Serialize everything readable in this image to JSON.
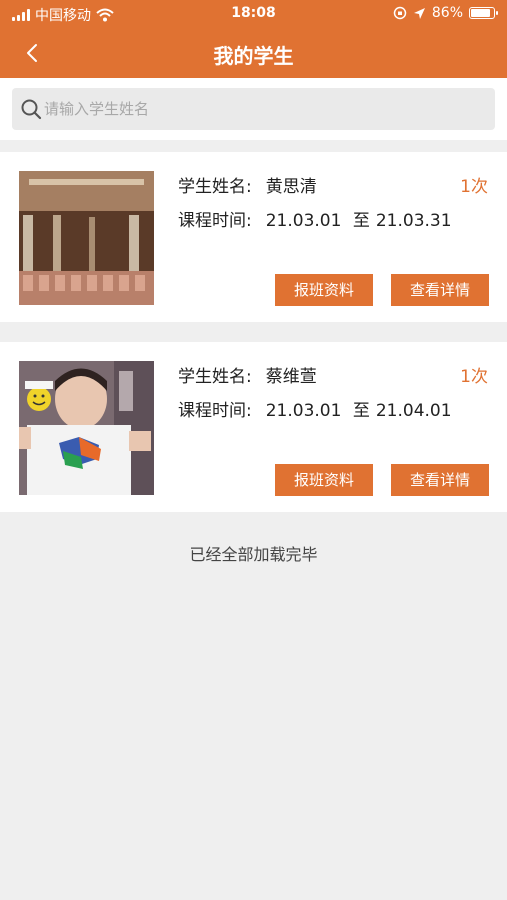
{
  "status_bar": {
    "carrier": "中国移动",
    "time": "18:08",
    "battery": "86%",
    "battery_level": 0.86
  },
  "nav": {
    "title": "我的学生",
    "back_icon": "chevron-left-icon"
  },
  "search": {
    "placeholder": "请输入学生姓名",
    "value": "",
    "icon": "search-icon"
  },
  "students": [
    {
      "name_label": "学生姓名:",
      "name": "黄思清",
      "time_label": "课程时间:",
      "start": "21.03.01",
      "sep": "至",
      "end": "21.03.31",
      "count": "1次",
      "enroll_label": "报班资料",
      "detail_label": "查看详情"
    },
    {
      "name_label": "学生姓名:",
      "name": "蔡维萱",
      "time_label": "课程时间:",
      "start": "21.03.01",
      "sep": "至",
      "end": "21.04.01",
      "count": "1次",
      "enroll_label": "报班资料",
      "detail_label": "查看详情"
    }
  ],
  "footer": {
    "text": "已经全部加载完毕"
  },
  "colors": {
    "accent": "#e07232",
    "background": "#efefef"
  }
}
